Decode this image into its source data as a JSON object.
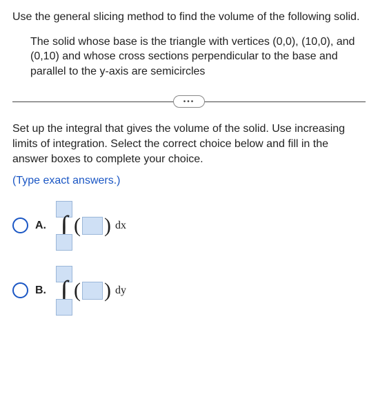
{
  "intro": "Use the general slicing method to find the volume of the following solid.",
  "solid_description": "The solid whose base is the triangle with vertices (0,0), (10,0), and (0,10) and whose cross sections perpendicular to the base and parallel to the y-axis are semicircles",
  "divider_label": "•••",
  "instructions": "Set up the integral that gives the volume of the solid. Use increasing limits of integration. Select the correct choice below and fill in the answer boxes to complete your choice.",
  "hint": "(Type exact answers.)",
  "choices": [
    {
      "letter": "A.",
      "differential": "dx"
    },
    {
      "letter": "B.",
      "differential": "dy"
    }
  ],
  "integral_symbol": "∫",
  "paren_open": "(",
  "paren_close": ")"
}
